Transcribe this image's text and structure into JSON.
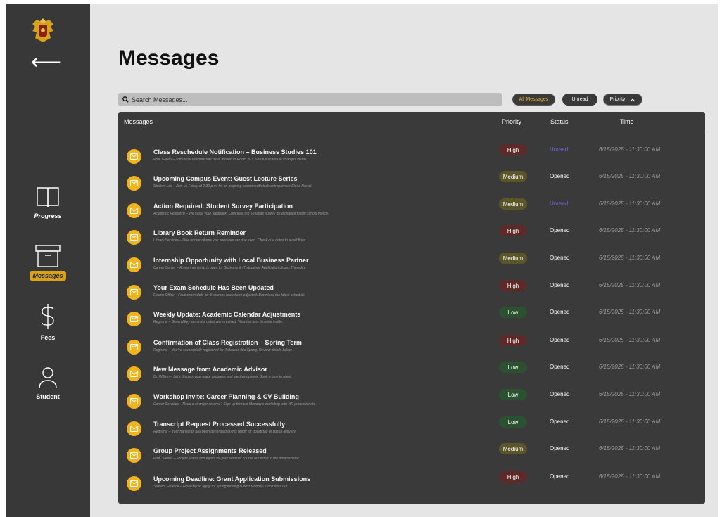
{
  "sidebar": {
    "back_arrow": "⟵",
    "crest_icon": "crest-logo",
    "items": [
      {
        "label": "Progress",
        "icon": "book-icon",
        "active": false
      },
      {
        "label": "Messages",
        "icon": "archive-box-icon",
        "active": true
      },
      {
        "label": "Fees",
        "icon": "dollar-icon",
        "active": false
      },
      {
        "label": "Student",
        "icon": "user-icon",
        "active": false
      }
    ]
  },
  "page": {
    "title": "Messages"
  },
  "search": {
    "placeholder": "Search Messages..."
  },
  "filters": {
    "all": "All Messages",
    "unread": "Unread",
    "priority": "Priority",
    "priority_icon": "chevron-up-icon"
  },
  "table": {
    "headers": {
      "messages": "Messages",
      "priority": "Priority",
      "status": "Status",
      "time": "Time"
    },
    "rows": [
      {
        "subject": "Class Reschedule Notification – Business Studies 101",
        "preview": "Prof. Green – Tomorrow's lecture has been moved to Room 203. See full schedule changes inside.",
        "priority": "High",
        "status": "Unread",
        "time": "6/15/2025 - 11:30:00 AM"
      },
      {
        "subject": "Upcoming Campus Event: Guest Lecture Series",
        "preview": "Student Life – Join us Friday at 2:30 p.m. for an inspiring session with tech entrepreneur Elena Novak.",
        "priority": "Medium",
        "status": "Opened",
        "time": "6/15/2025 - 11:30:00 AM"
      },
      {
        "subject": "Action Required: Student Survey Participation",
        "preview": "Academic Research – We value your feedback! Complete the 5-minute survey for a chance to win school merch.",
        "priority": "Medium",
        "status": "Unread",
        "time": "6/15/2025 - 11:30:00 AM"
      },
      {
        "subject": "Library Book Return Reminder",
        "preview": "Library Services – One or more items you borrowed are due soon. Check due dates to avoid fines.",
        "priority": "High",
        "status": "Opened",
        "time": "6/15/2025 - 11:30:00 AM"
      },
      {
        "subject": "Internship Opportunity with Local Business Partner",
        "preview": "Career Center – A new internship is open for Business & IT students. Application closes Thursday.",
        "priority": "Medium",
        "status": "Opened",
        "time": "6/15/2025 - 11:30:00 AM"
      },
      {
        "subject": "Your Exam Schedule Has Been Updated",
        "preview": "Exams Office – Final exam slots for 3 courses have been adjusted. Download the latest schedule.",
        "priority": "High",
        "status": "Opened",
        "time": "6/15/2025 - 11:30:00 AM"
      },
      {
        "subject": "Weekly Update: Academic Calendar Adjustments",
        "preview": "Registrar – Several key semester dates were revised. View the new timeline inside.",
        "priority": "Low",
        "status": "Opened",
        "time": "6/15/2025 - 11:30:00 AM"
      },
      {
        "subject": "Confirmation of Class Registration – Spring Term",
        "preview": "Registrar – You've successfully registered for 4 classes this Spring. Review details below.",
        "priority": "High",
        "status": "Opened",
        "time": "6/15/2025 - 11:30:00 AM"
      },
      {
        "subject": "New Message from Academic Advisor",
        "preview": "Dr. Willem – Let's discuss your major progress and elective options. Book a time to meet.",
        "priority": "Low",
        "status": "Opened",
        "time": "6/15/2025 - 11:30:00 AM"
      },
      {
        "subject": "Workshop Invite: Career Planning & CV Building",
        "preview": "Career Services – Need a stronger resume? Sign up for next Monday's workshop with HR professionals.",
        "priority": "Low",
        "status": "Opened",
        "time": "6/15/2025 - 11:30:00 AM"
      },
      {
        "subject": "Transcript Request Processed Successfully",
        "preview": "Registrar – Your transcript has been generated and is ready for download or postal delivery.",
        "priority": "Low",
        "status": "Opened",
        "time": "6/15/2025 - 11:30:00 AM"
      },
      {
        "subject": "Group Project Assignments Released",
        "preview": "Prof. Santos – Project teams and topics for your seminar course are listed in the attached doc.",
        "priority": "Medium",
        "status": "Opened",
        "time": "6/15/2025 - 11:30:00 AM"
      },
      {
        "subject": "Upcoming Deadline: Grant Application Submissions",
        "preview": "Student Finance – Final day to apply for spring funding is next Monday. Don't miss out.",
        "priority": "High",
        "status": "Opened",
        "time": "6/15/2025 - 11:30:00 AM"
      }
    ]
  }
}
